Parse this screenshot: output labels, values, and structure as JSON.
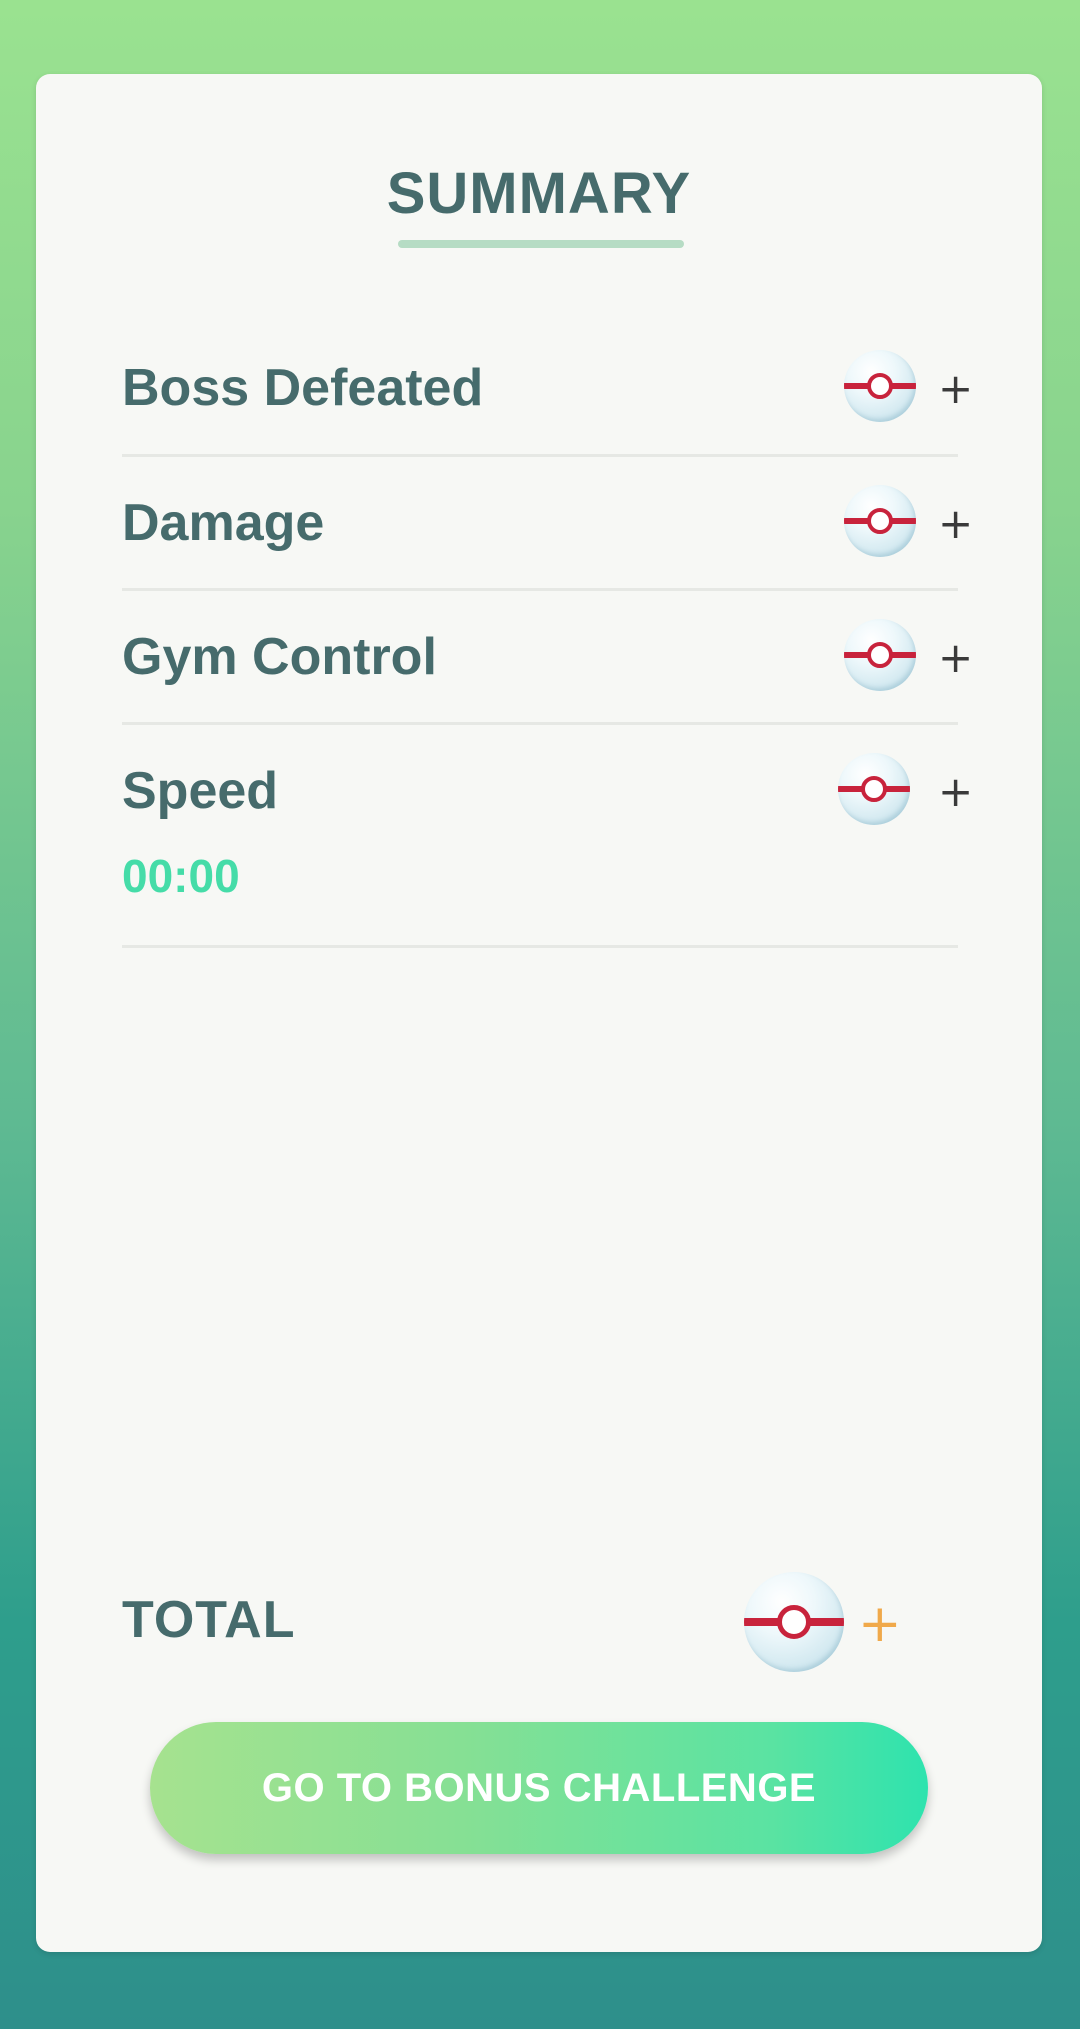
{
  "summary": {
    "title": "SUMMARY",
    "rows": [
      {
        "label": "Boss Defeated",
        "bonus": "+"
      },
      {
        "label": "Damage",
        "bonus": "+"
      },
      {
        "label": "Gym Control",
        "bonus": "+"
      },
      {
        "label": "Speed",
        "time": "00:00",
        "bonus": "+"
      }
    ],
    "total": {
      "label": "TOTAL",
      "bonus": "+"
    }
  },
  "actions": {
    "bonus_challenge_label": "GO TO BONUS CHALLENGE"
  },
  "icons": {
    "reward_item": "premier-ball-icon"
  },
  "colors": {
    "heading": "#466b6c",
    "time": "#45dca8",
    "total_plus": "#f0a94a",
    "button_start": "#a6e28f",
    "button_end": "#2ee3ae"
  }
}
